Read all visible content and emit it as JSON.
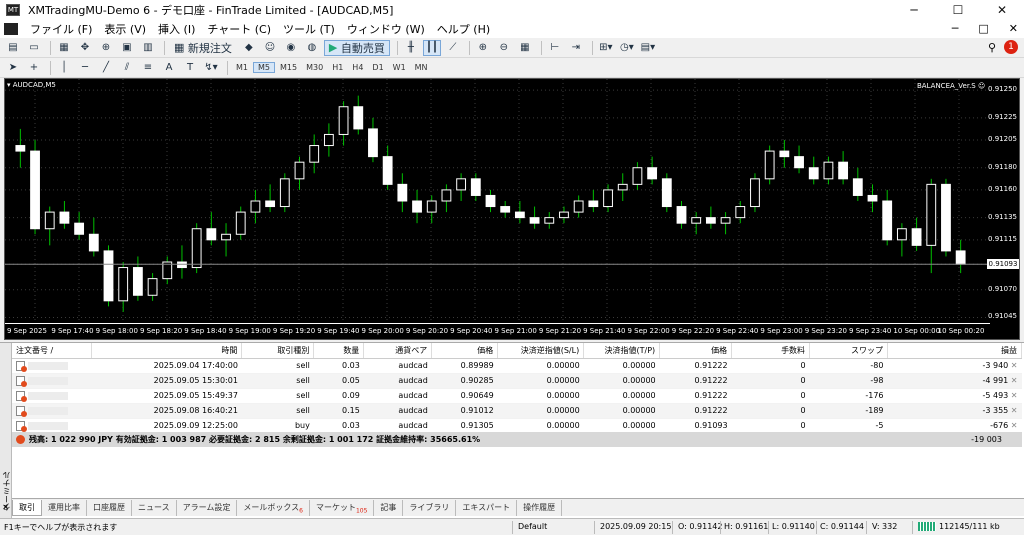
{
  "window": {
    "title": "XMTradingMU-Demo 6 - デモ口座 - FinTrade Limited - [AUDCAD,M5]",
    "controls": [
      "─",
      "☐",
      "✕"
    ]
  },
  "menu": {
    "items": [
      "ファイル (F)",
      "表示 (V)",
      "挿入 (I)",
      "チャート (C)",
      "ツール (T)",
      "ウィンドウ (W)",
      "ヘルプ (H)"
    ],
    "right": [
      "─",
      "□",
      "✕"
    ]
  },
  "toolbar": {
    "new_order": "新規注文",
    "auto_trade": "自動売買",
    "notification_count": "1"
  },
  "timeframes": [
    "M1",
    "M5",
    "M15",
    "M30",
    "H1",
    "H4",
    "D1",
    "W1",
    "MN"
  ],
  "active_timeframe": "M5",
  "chart": {
    "symbol_label": "AUDCAD,M5",
    "indicator_label": "BALANCEA_Ver.S",
    "current_price": "0.91093",
    "candle_colors": {
      "up": "#ffffff",
      "down": "#ffffff",
      "wick": "#00c000",
      "background": "#000000",
      "grid": "#3a3a3a"
    }
  },
  "chart_data": {
    "type": "candlestick",
    "symbol": "AUDCAD",
    "timeframe": "M5",
    "y_ticks": [
      "0.91250",
      "0.91225",
      "0.91205",
      "0.91180",
      "0.91160",
      "0.91135",
      "0.91115",
      "0.91093",
      "0.91070",
      "0.91045"
    ],
    "x_ticks": [
      "9 Sep 2025",
      "9 Sep 17:40",
      "9 Sep 18:00",
      "9 Sep 18:20",
      "9 Sep 18:40",
      "9 Sep 19:00",
      "9 Sep 19:20",
      "9 Sep 19:40",
      "9 Sep 20:00",
      "9 Sep 20:20",
      "9 Sep 20:40",
      "9 Sep 21:00",
      "9 Sep 21:20",
      "9 Sep 21:40",
      "9 Sep 22:00",
      "9 Sep 22:20",
      "9 Sep 22:40",
      "9 Sep 23:00",
      "9 Sep 23:20",
      "9 Sep 23:40",
      "10 Sep 00:00",
      "10 Sep 00:20"
    ],
    "ylim": [
      0.9104,
      0.9126
    ],
    "candles": [
      [
        0.912,
        0.91215,
        0.9118,
        0.91195
      ],
      [
        0.91195,
        0.91205,
        0.9112,
        0.91125
      ],
      [
        0.91125,
        0.91145,
        0.9111,
        0.9114
      ],
      [
        0.9114,
        0.9115,
        0.91125,
        0.9113
      ],
      [
        0.9113,
        0.9114,
        0.91115,
        0.9112
      ],
      [
        0.9112,
        0.91135,
        0.911,
        0.91105
      ],
      [
        0.91105,
        0.9111,
        0.91055,
        0.9106
      ],
      [
        0.9106,
        0.91095,
        0.9105,
        0.9109
      ],
      [
        0.9109,
        0.911,
        0.9106,
        0.91065
      ],
      [
        0.91065,
        0.91085,
        0.9106,
        0.9108
      ],
      [
        0.9108,
        0.911,
        0.91075,
        0.91095
      ],
      [
        0.91095,
        0.9111,
        0.9108,
        0.9109
      ],
      [
        0.9109,
        0.9113,
        0.91085,
        0.91125
      ],
      [
        0.91125,
        0.9114,
        0.9111,
        0.91115
      ],
      [
        0.91115,
        0.9113,
        0.911,
        0.9112
      ],
      [
        0.9112,
        0.91145,
        0.91115,
        0.9114
      ],
      [
        0.9114,
        0.9116,
        0.9113,
        0.9115
      ],
      [
        0.9115,
        0.91165,
        0.9114,
        0.91145
      ],
      [
        0.91145,
        0.91175,
        0.9114,
        0.9117
      ],
      [
        0.9117,
        0.9119,
        0.9116,
        0.91185
      ],
      [
        0.91185,
        0.9121,
        0.91175,
        0.912
      ],
      [
        0.912,
        0.9122,
        0.9119,
        0.9121
      ],
      [
        0.9121,
        0.9124,
        0.912,
        0.91235
      ],
      [
        0.91235,
        0.91245,
        0.9121,
        0.91215
      ],
      [
        0.91215,
        0.91225,
        0.91185,
        0.9119
      ],
      [
        0.9119,
        0.912,
        0.9116,
        0.91165
      ],
      [
        0.91165,
        0.91175,
        0.9114,
        0.9115
      ],
      [
        0.9115,
        0.9116,
        0.9113,
        0.9114
      ],
      [
        0.9114,
        0.91155,
        0.9113,
        0.9115
      ],
      [
        0.9115,
        0.91165,
        0.9114,
        0.9116
      ],
      [
        0.9116,
        0.91175,
        0.9115,
        0.9117
      ],
      [
        0.9117,
        0.91175,
        0.9115,
        0.91155
      ],
      [
        0.91155,
        0.9116,
        0.9114,
        0.91145
      ],
      [
        0.91145,
        0.9115,
        0.91135,
        0.9114
      ],
      [
        0.9114,
        0.9115,
        0.9113,
        0.91135
      ],
      [
        0.91135,
        0.91145,
        0.91125,
        0.9113
      ],
      [
        0.9113,
        0.9114,
        0.91125,
        0.91135
      ],
      [
        0.91135,
        0.91145,
        0.9113,
        0.9114
      ],
      [
        0.9114,
        0.91155,
        0.91135,
        0.9115
      ],
      [
        0.9115,
        0.9116,
        0.9114,
        0.91145
      ],
      [
        0.91145,
        0.91165,
        0.9114,
        0.9116
      ],
      [
        0.9116,
        0.91175,
        0.9115,
        0.91165
      ],
      [
        0.91165,
        0.91185,
        0.9116,
        0.9118
      ],
      [
        0.9118,
        0.9119,
        0.91165,
        0.9117
      ],
      [
        0.9117,
        0.91175,
        0.9114,
        0.91145
      ],
      [
        0.91145,
        0.9115,
        0.91125,
        0.9113
      ],
      [
        0.9113,
        0.9114,
        0.9112,
        0.91135
      ],
      [
        0.91135,
        0.91145,
        0.91125,
        0.9113
      ],
      [
        0.9113,
        0.9114,
        0.9112,
        0.91135
      ],
      [
        0.91135,
        0.9115,
        0.9113,
        0.91145
      ],
      [
        0.91145,
        0.91175,
        0.9114,
        0.9117
      ],
      [
        0.9117,
        0.912,
        0.91165,
        0.91195
      ],
      [
        0.91195,
        0.91205,
        0.9118,
        0.9119
      ],
      [
        0.9119,
        0.912,
        0.91175,
        0.9118
      ],
      [
        0.9118,
        0.9119,
        0.91165,
        0.9117
      ],
      [
        0.9117,
        0.9119,
        0.91165,
        0.91185
      ],
      [
        0.91185,
        0.91195,
        0.91165,
        0.9117
      ],
      [
        0.9117,
        0.9118,
        0.9115,
        0.91155
      ],
      [
        0.91155,
        0.91165,
        0.9114,
        0.9115
      ],
      [
        0.9115,
        0.9116,
        0.9111,
        0.91115
      ],
      [
        0.91115,
        0.9113,
        0.911,
        0.91125
      ],
      [
        0.91125,
        0.91135,
        0.91105,
        0.9111
      ],
      [
        0.9111,
        0.9117,
        0.91085,
        0.91165
      ],
      [
        0.91165,
        0.9117,
        0.911,
        0.91105
      ],
      [
        0.91105,
        0.91115,
        0.91085,
        0.91093
      ]
    ]
  },
  "orders": {
    "headers": [
      "注文番号",
      "/",
      "時間",
      "取引種別",
      "数量",
      "通貨ペア",
      "価格",
      "決済逆指値(S/L)",
      "決済指値(T/P)",
      "価格",
      "手数料",
      "スワップ",
      "損益"
    ],
    "rows": [
      {
        "id": "",
        "time": "2025.09.04 17:40:00",
        "type": "sell",
        "volume": "0.03",
        "symbol": "audcad",
        "price": "0.89989",
        "sl": "0.00000",
        "tp": "0.00000",
        "cur_price": "0.91222",
        "commission": "0",
        "swap": "-80",
        "profit": "-3 940"
      },
      {
        "id": "",
        "time": "2025.09.05 15:30:01",
        "type": "sell",
        "volume": "0.05",
        "symbol": "audcad",
        "price": "0.90285",
        "sl": "0.00000",
        "tp": "0.00000",
        "cur_price": "0.91222",
        "commission": "0",
        "swap": "-98",
        "profit": "-4 991"
      },
      {
        "id": "",
        "time": "2025.09.05 15:49:37",
        "type": "sell",
        "volume": "0.09",
        "symbol": "audcad",
        "price": "0.90649",
        "sl": "0.00000",
        "tp": "0.00000",
        "cur_price": "0.91222",
        "commission": "0",
        "swap": "-176",
        "profit": "-5 493"
      },
      {
        "id": "",
        "time": "2025.09.08 16:40:21",
        "type": "sell",
        "volume": "0.15",
        "symbol": "audcad",
        "price": "0.91012",
        "sl": "0.00000",
        "tp": "0.00000",
        "cur_price": "0.91222",
        "commission": "0",
        "swap": "-189",
        "profit": "-3 355"
      },
      {
        "id": "",
        "time": "2025.09.09 12:25:00",
        "type": "buy",
        "volume": "0.03",
        "symbol": "audcad",
        "price": "0.91305",
        "sl": "0.00000",
        "tp": "0.00000",
        "cur_price": "0.91093",
        "commission": "0",
        "swap": "-5",
        "profit": "-676"
      }
    ],
    "summary": "残高: 1 022 990 JPY  有効証拠金: 1 003 987  必要証拠金: 2 815  余剰証拠金: 1 001 172  証拠金維持率: 35665.61%",
    "total": "-19 003"
  },
  "terminal_label": "ターミナル",
  "tabs": [
    {
      "label": "取引",
      "badge": ""
    },
    {
      "label": "運用比率",
      "badge": ""
    },
    {
      "label": "口座履歴",
      "badge": ""
    },
    {
      "label": "ニュース",
      "badge": ""
    },
    {
      "label": "アラーム設定",
      "badge": ""
    },
    {
      "label": "メールボックス",
      "badge": "6"
    },
    {
      "label": "マーケット",
      "badge": "105"
    },
    {
      "label": "記事",
      "badge": ""
    },
    {
      "label": "ライブラリ",
      "badge": ""
    },
    {
      "label": "エキスパート",
      "badge": ""
    },
    {
      "label": "操作履歴",
      "badge": ""
    }
  ],
  "status": {
    "help": "F1キーでヘルプが表示されます",
    "profile": "Default",
    "datetime": "2025.09.09 20:15",
    "open": "O: 0.91142",
    "high": "H: 0.91161",
    "low": "L: 0.91140",
    "close": "C: 0.91144",
    "volume": "V: 332",
    "traffic": "112145/111 kb"
  }
}
